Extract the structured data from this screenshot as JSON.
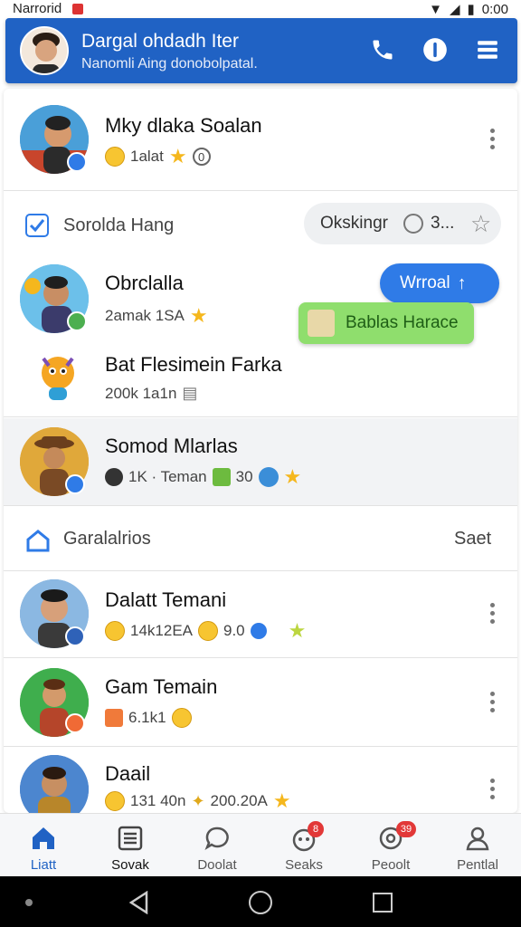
{
  "status_bar": {
    "left_text": "Narrorid",
    "time": "0:00"
  },
  "app_bar": {
    "title": "Dargal ohdadh Iter",
    "subtitle": "Nanomli Aing donobolpatal.",
    "icons": [
      "phone-icon",
      "info-icon",
      "menu-icon"
    ],
    "color": "#2062c4"
  },
  "top_contact": {
    "name": "Mky dlaka Soalan",
    "meta": "1alat",
    "meta_tail": "0"
  },
  "section_friends": {
    "title": "Sorolda Hang",
    "search_text": "Okskingr",
    "search_count": "3..."
  },
  "contacts": [
    {
      "name": "Obrclalla",
      "meta": "2amak 1SA"
    },
    {
      "name": "Bat Flesimein Farka",
      "meta": "200k 1a1n"
    },
    {
      "name": "Somod Mlarlas",
      "meta": "1K · Teman",
      "count": "30"
    }
  ],
  "bubbles": {
    "blue": "Wrroal",
    "green": "Bablas Harace"
  },
  "section_games": {
    "title": "Garalalrios",
    "action": "Saet"
  },
  "game_contacts": [
    {
      "name": "Dalatt Temani",
      "meta": "14k12EA",
      "value": "9.0"
    },
    {
      "name": "Gam Temain",
      "meta": "6.1k1"
    },
    {
      "name": "Daail",
      "meta": "131 40n",
      "value": "200.20A"
    }
  ],
  "bottom_nav": {
    "items": [
      {
        "label": "Liatt",
        "icon": "home-icon"
      },
      {
        "label": "Sovak",
        "icon": "list-icon"
      },
      {
        "label": "Doolat",
        "icon": "chat-icon"
      },
      {
        "label": "Seaks",
        "icon": "group-icon",
        "badge": "8"
      },
      {
        "label": "Peoolt",
        "icon": "target-icon",
        "badge": "39"
      },
      {
        "label": "Pentlal",
        "icon": "profile-icon"
      }
    ]
  },
  "accent_colors": {
    "blue": "#2f7be7",
    "green": "#8fde6d",
    "star": "#f5b71d"
  }
}
